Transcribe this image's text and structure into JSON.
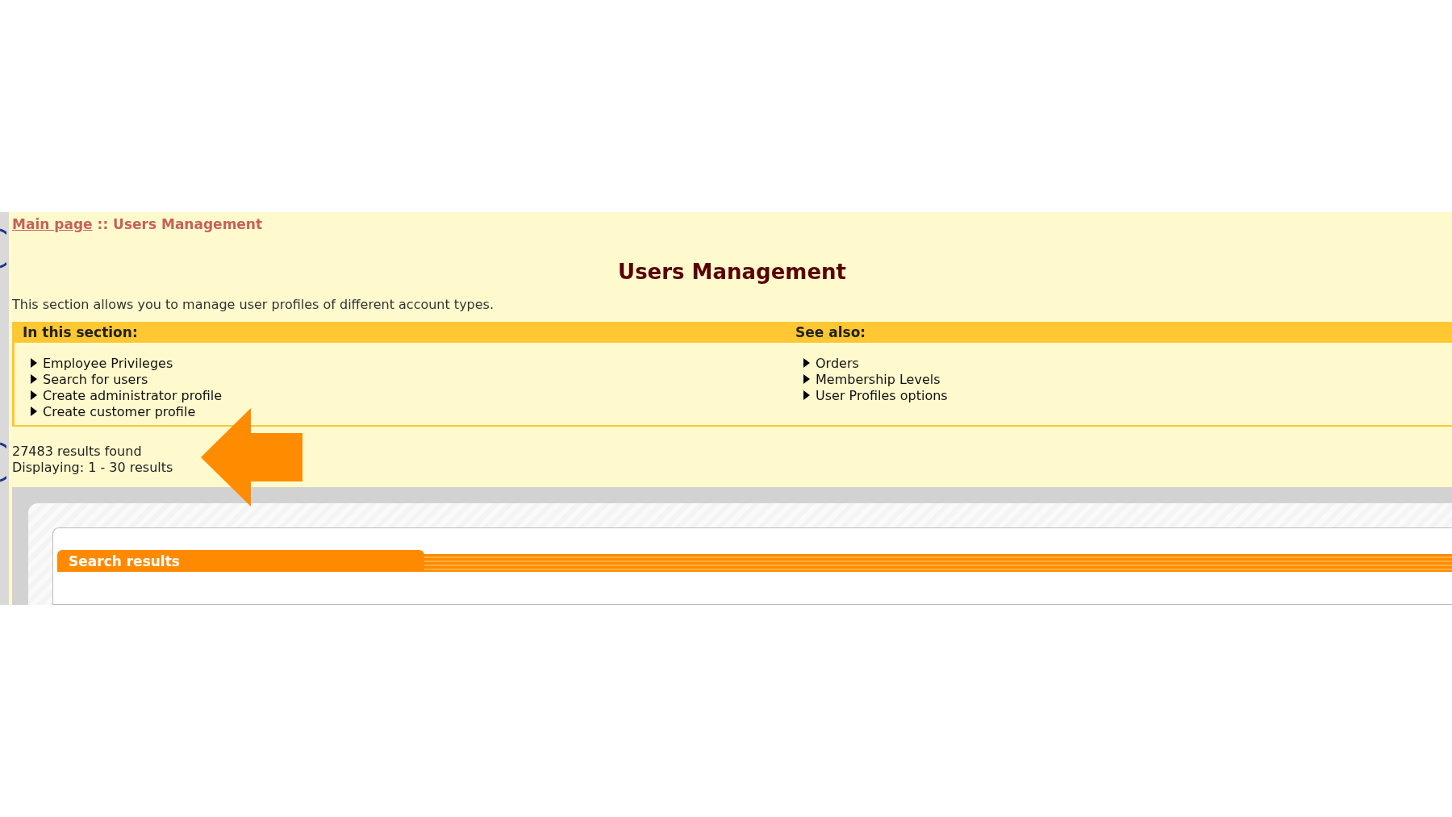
{
  "breadcrumb": {
    "link": "Main page",
    "separator": "::",
    "current": "Users Management"
  },
  "title": "Users Management",
  "description": "This section allows you to manage user profiles of different account types.",
  "sections": [
    {
      "heading": "In this section:",
      "items": [
        "Employee Privileges",
        "Search for users",
        "Create administrator profile",
        "Create customer profile"
      ]
    },
    {
      "heading": "See also:",
      "items": [
        "Orders",
        "Membership Levels",
        "User Profiles options"
      ]
    }
  ],
  "results": {
    "found": "27483 results found",
    "displaying": "Displaying: 1 - 30 results"
  },
  "panel": {
    "tab": "Search results"
  }
}
